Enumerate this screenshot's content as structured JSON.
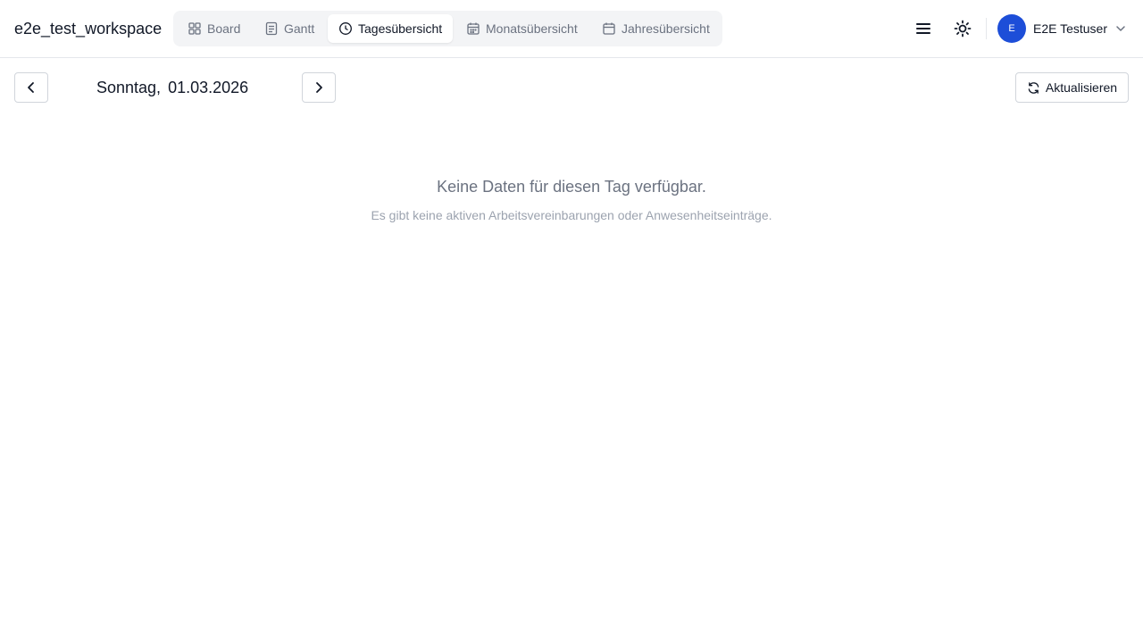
{
  "app": {
    "workspace_title": "e2e_test_workspace"
  },
  "tabs": [
    {
      "label": "Board",
      "icon": "grid-icon",
      "active": false
    },
    {
      "label": "Gantt",
      "icon": "document-icon",
      "active": false
    },
    {
      "label": "Tagesübersicht",
      "icon": "clock-icon",
      "active": true
    },
    {
      "label": "Monatsübersicht",
      "icon": "calendar-icon",
      "active": false
    },
    {
      "label": "Jahresübersicht",
      "icon": "calendar-icon",
      "active": false
    }
  ],
  "header_actions": {
    "menu_icon": "hamburger-menu-icon",
    "theme_icon": "sun-icon"
  },
  "user": {
    "avatar_initial": "E",
    "name": "E2E Testuser",
    "avatar_color": "#1d4ed8"
  },
  "day_nav": {
    "weekday": "Sonntag,",
    "date": "01.03.2026",
    "prev_icon": "chevron-left-icon",
    "next_icon": "chevron-right-icon"
  },
  "refresh": {
    "label": "Aktualisieren",
    "icon": "refresh-icon"
  },
  "empty_state": {
    "title": "Keine Daten für diesen Tag verfügbar.",
    "subtitle": "Es gibt keine aktiven Arbeitsvereinbarungen oder Anwesenheitseinträge."
  }
}
